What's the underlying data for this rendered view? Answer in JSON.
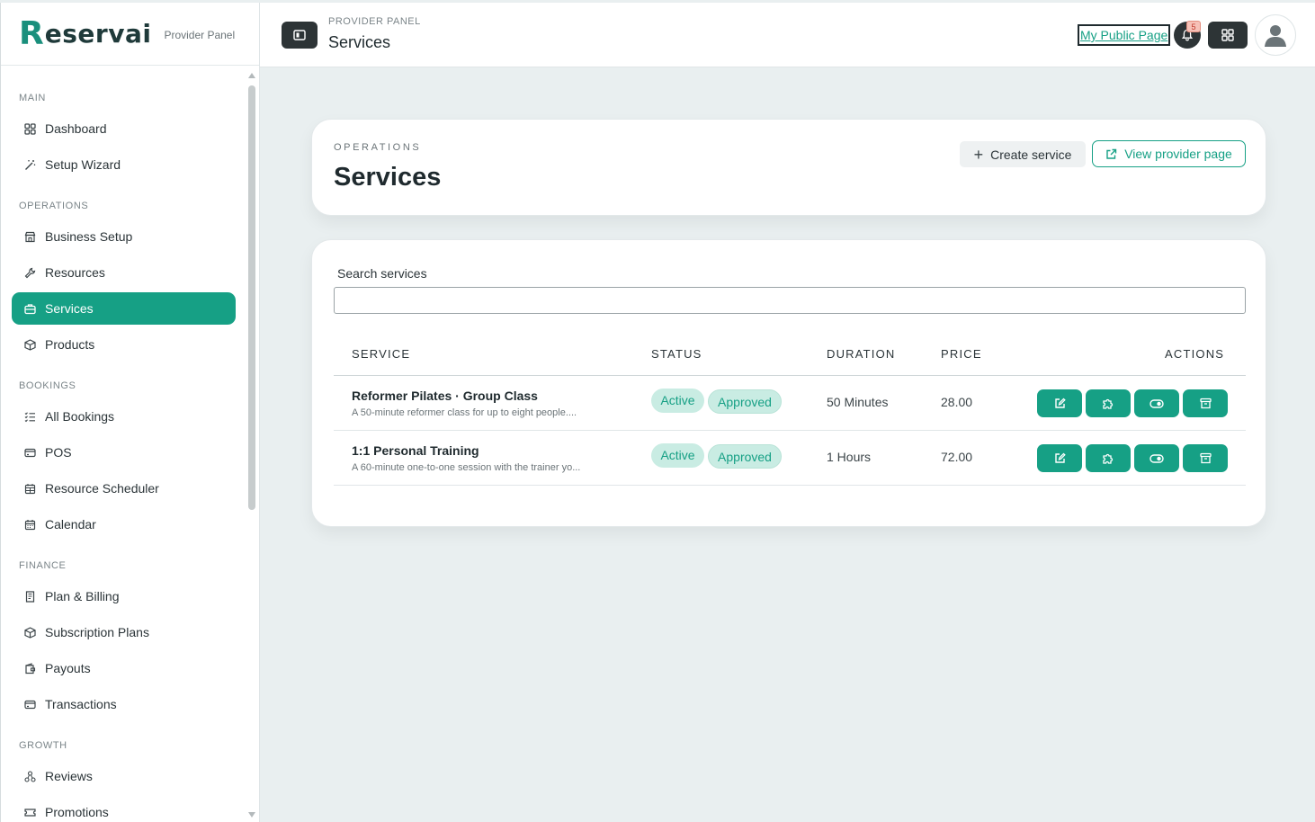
{
  "brand": {
    "logo_initial": "R",
    "logo_rest": "eservai",
    "subtitle": "Provider Panel"
  },
  "sidebar": {
    "sections": [
      {
        "title": "MAIN",
        "items": [
          {
            "label": "Dashboard",
            "icon": "grid-icon"
          },
          {
            "label": "Setup Wizard",
            "icon": "magic-wand-icon"
          }
        ]
      },
      {
        "title": "OPERATIONS",
        "items": [
          {
            "label": "Business Setup",
            "icon": "storefront-icon"
          },
          {
            "label": "Resources",
            "icon": "wrench-icon"
          },
          {
            "label": "Services",
            "icon": "briefcase-icon",
            "active": true
          },
          {
            "label": "Products",
            "icon": "box-icon"
          }
        ]
      },
      {
        "title": "BOOKINGS",
        "items": [
          {
            "label": "All Bookings",
            "icon": "list-check-icon"
          },
          {
            "label": "POS",
            "icon": "credit-card-icon"
          },
          {
            "label": "Resource Scheduler",
            "icon": "calendar-grid-icon"
          },
          {
            "label": "Calendar",
            "icon": "calendar-icon"
          }
        ]
      },
      {
        "title": "FINANCE",
        "items": [
          {
            "label": "Plan & Billing",
            "icon": "receipt-icon"
          },
          {
            "label": "Subscription Plans",
            "icon": "box-icon"
          },
          {
            "label": "Payouts",
            "icon": "wallet-icon"
          },
          {
            "label": "Transactions",
            "icon": "credit-card-icon"
          }
        ]
      },
      {
        "title": "GROWTH",
        "items": [
          {
            "label": "Reviews",
            "icon": "shapes-icon"
          },
          {
            "label": "Promotions",
            "icon": "ticket-icon"
          }
        ]
      }
    ]
  },
  "topbar": {
    "breadcrumb": "PROVIDER PANEL",
    "title": "Services",
    "public_link": "My Public Page",
    "notification_count": "5"
  },
  "header_card": {
    "eyebrow": "OPERATIONS",
    "title": "Services",
    "create_label": "Create service",
    "view_label": "View provider page"
  },
  "search": {
    "label": "Search services",
    "value": "",
    "placeholder": ""
  },
  "table": {
    "columns": [
      "SERVICE",
      "STATUS",
      "DURATION",
      "PRICE",
      "ACTIONS"
    ],
    "rows": [
      {
        "name": "Reformer Pilates · Group Class",
        "description": "A 50-minute reformer class for up to eight people....",
        "status": "Active",
        "approval": "Approved",
        "duration": "50 Minutes",
        "price": "28.00"
      },
      {
        "name": "1:1 Personal Training",
        "description": "A 60-minute one-to-one session with the trainer yo...",
        "status": "Active",
        "approval": "Approved",
        "duration": "1 Hours",
        "price": "72.00"
      }
    ],
    "action_icons": [
      "edit-icon",
      "puzzle-icon",
      "toggle-icon",
      "archive-icon"
    ]
  },
  "colors": {
    "accent": "#16a085",
    "dark": "#2d3436",
    "badge_bg": "#c9ece3",
    "page_bg": "#e9eff0"
  }
}
